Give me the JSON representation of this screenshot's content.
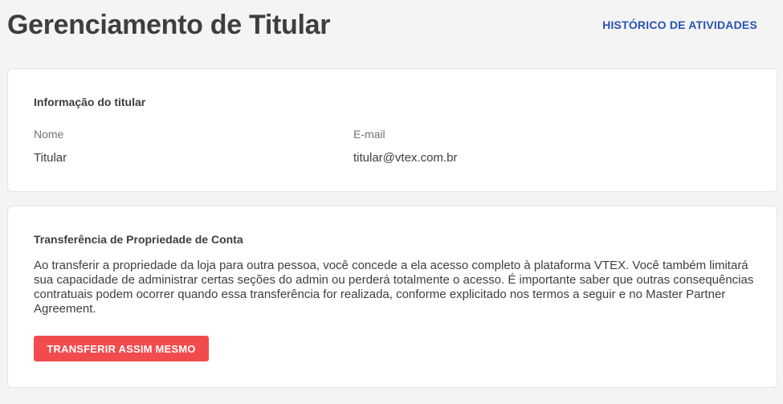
{
  "header": {
    "title": "Gerenciamento de Titular",
    "activity_link": "HISTÓRICO DE ATIVIDADES"
  },
  "holder_info": {
    "title": "Informação do titular",
    "name_label": "Nome",
    "name_value": "Titular",
    "email_label": "E-mail",
    "email_value": "titular@vtex.com.br"
  },
  "transfer": {
    "title": "Transferência de Propriedade de Conta",
    "description": "Ao transferir a propriedade da loja para outra pessoa, você concede a ela acesso completo à plataforma VTEX. Você também limitará sua capacidade de administrar certas seções do admin ou perderá totalmente o acesso. É importante saber que outras consequências contratuais podem ocorrer quando essa transferência for realizada, conforme explicitado nos termos a seguir e no Master Partner Agreement.",
    "button_label": "TRANSFERIR ASSIM MESMO"
  },
  "colors": {
    "background": "#f4f4f5",
    "link": "#2953b2",
    "danger": "#f14b4e",
    "text": "#3d3e40",
    "muted": "#727273"
  }
}
